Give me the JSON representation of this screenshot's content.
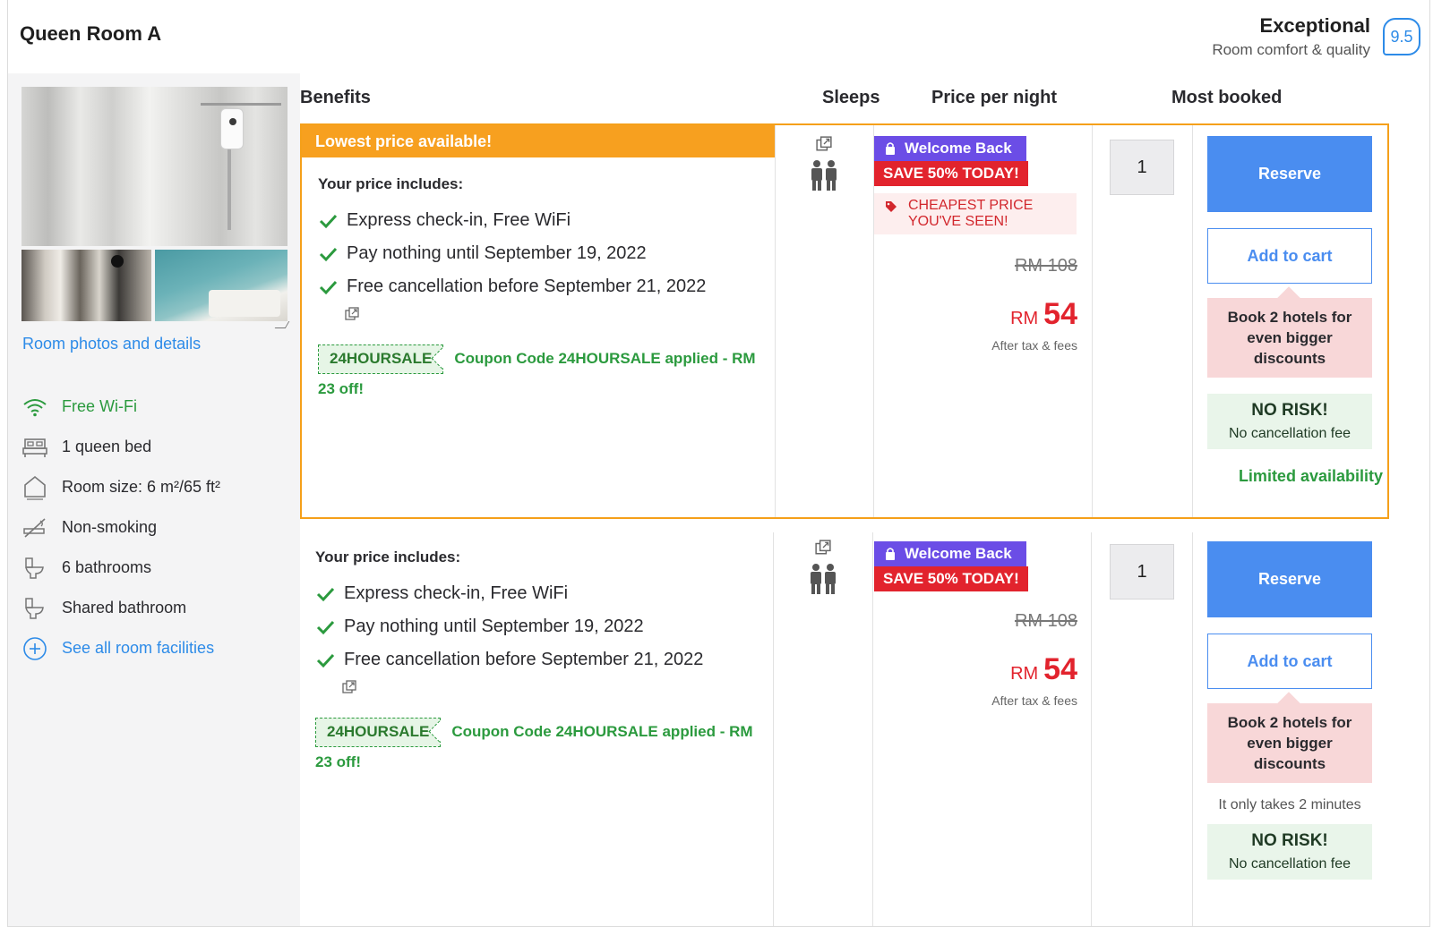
{
  "room": {
    "title": "Queen Room A",
    "rating_label": "Exceptional",
    "rating_sub": "Room comfort & quality",
    "rating_score": "9.5"
  },
  "photos_link": "Room photos and details",
  "facilities": [
    {
      "label": "Free Wi-Fi",
      "icon": "wifi-icon"
    },
    {
      "label": "1 queen bed",
      "icon": "bed-icon"
    },
    {
      "label": "Room size: 6 m²/65 ft²",
      "icon": "room-size-icon"
    },
    {
      "label": "Non-smoking",
      "icon": "no-smoking-icon"
    },
    {
      "label": "6 bathrooms",
      "icon": "toilet-icon"
    },
    {
      "label": "Shared bathroom",
      "icon": "toilet-icon"
    },
    {
      "label": "See all room facilities",
      "icon": "plus-circle-icon"
    }
  ],
  "headers": {
    "benefits": "Benefits",
    "sleeps": "Sleeps",
    "price": "Price per night",
    "most_booked": "Most booked"
  },
  "offers": [
    {
      "banner": "Lowest price available!",
      "includes_title": "Your price includes:",
      "benefits": [
        "Express check-in, Free WiFi",
        "Pay nothing until September 19, 2022",
        "Free cancellation before September 21, 2022"
      ],
      "coupon_code": "24HOURSALE",
      "coupon_text": "Coupon Code 24HOURSALE applied - RM 23 off!",
      "welcome_badge": "Welcome Back",
      "save_badge": "SAVE 50% TODAY!",
      "cheapest": "CHEAPEST PRICE YOU'VE SEEN!",
      "old_price": "RM 108",
      "currency": "RM",
      "price": "54",
      "after_tax": "After tax & fees",
      "quantity": "1",
      "reserve": "Reserve",
      "add_to_cart": "Add to cart",
      "promo": "Book 2 hotels for even bigger discounts",
      "no_risk_title": "NO RISK!",
      "no_risk_sub": "No cancellation fee",
      "limited": "Limited availability"
    },
    {
      "includes_title": "Your price includes:",
      "benefits": [
        "Express check-in, Free WiFi",
        "Pay nothing until September 19, 2022",
        "Free cancellation before September 21, 2022"
      ],
      "coupon_code": "24HOURSALE",
      "coupon_text": "Coupon Code 24HOURSALE applied - RM 23 off!",
      "welcome_badge": "Welcome Back",
      "save_badge": "SAVE 50% TODAY!",
      "old_price": "RM 108",
      "currency": "RM",
      "price": "54",
      "after_tax": "After tax & fees",
      "quantity": "1",
      "reserve": "Reserve",
      "add_to_cart": "Add to cart",
      "promo": "Book 2 hotels for even bigger discounts",
      "takes": "It only takes 2 minutes",
      "no_risk_title": "NO RISK!",
      "no_risk_sub": "No cancellation fee"
    }
  ],
  "colors": {
    "accent_blue": "#4a8df0",
    "orange": "#f7a01f",
    "green": "#2b9a3e",
    "red": "#e2232d",
    "purple": "#6b4de6"
  }
}
